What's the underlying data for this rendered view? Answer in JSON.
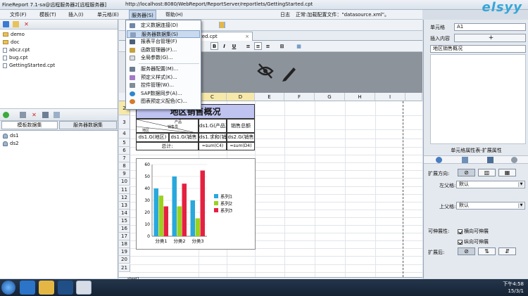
{
  "window": {
    "title": "FineReport 7.1-sa@远程服务器2[远程服务器]",
    "url": "http://localhost:8080/WebReport/ReportServer/reportlets/GettingStarted.cpt",
    "logo": "elsyy"
  },
  "menubar": {
    "items": [
      "文件(F)",
      "模板(T)",
      "插入(I)",
      "单元格(E)",
      "服务器(S)",
      "帮助(H)"
    ],
    "log_label": "日志",
    "status": "正常:加载配置文件：\"datasource.xml\"。"
  },
  "server_menu": {
    "items": [
      "定义数据连接(D)",
      "服务器数据集(S)",
      "报表平台管理(F)",
      "函数管理器(F)...",
      "全局参数(G)...",
      "服务器配置(M)...",
      "预定义样式(K)...",
      "控件管理(W)...",
      "SAP数据同步(A)...",
      "图表预定义配色(C)..."
    ],
    "highlighted_index": 1
  },
  "file_tree": {
    "items": [
      {
        "name": "demo",
        "type": "folder"
      },
      {
        "name": "doc",
        "type": "folder"
      },
      {
        "name": "abcz.cpt",
        "type": "file"
      },
      {
        "name": "bug.cpt",
        "type": "file"
      },
      {
        "name": "GettingStarted.cpt",
        "type": "file"
      }
    ]
  },
  "dataset_panel": {
    "tabs": [
      "模板数据集",
      "服务器数据集"
    ],
    "items": [
      "ds1",
      "ds2"
    ]
  },
  "doc_tab": {
    "label": "ted.cpt"
  },
  "format_bar": {
    "bold": "B",
    "italic": "I",
    "underline": "U"
  },
  "grid": {
    "columns": [
      "C",
      "D",
      "E",
      "F",
      "G",
      "H",
      "I"
    ],
    "rows": [
      "2",
      "3",
      "4",
      "5",
      "6",
      "7",
      "8",
      "9",
      "10",
      "11",
      "12",
      "13",
      "14",
      "15",
      "16",
      "17",
      "18",
      "19",
      "20",
      "21"
    ],
    "title_cell": "地区销售概况",
    "header_product": "产品",
    "header_sales": "销售员",
    "header_region": "地区",
    "cell_product": "ds1.G(产品)",
    "cell_sales_total": "销售总额",
    "cell_region": "ds1.G(地区)",
    "cell_sales": "ds1.G(销售",
    "cell_sum_qty": "ds1.求和(销",
    "cell_ds2": "ds2.G(销售",
    "total_label": "总计:",
    "sum_c4": "=sum(C4)",
    "sum_d4": "=sum(D4)"
  },
  "chart_data": {
    "type": "bar",
    "categories": [
      "分类1",
      "分类2",
      "分类3"
    ],
    "series": [
      {
        "name": "系列1",
        "values": [
          40,
          50,
          30
        ],
        "color": "#29a8de"
      },
      {
        "name": "系列2",
        "values": [
          34,
          25,
          15
        ],
        "color": "#9bd21c"
      },
      {
        "name": "系列3",
        "values": [
          25,
          44,
          55
        ],
        "color": "#e52140"
      }
    ],
    "ylim": [
      0,
      60
    ],
    "yticks": [
      "0",
      "10",
      "20",
      "30",
      "40",
      "50",
      "60"
    ],
    "legend": "right"
  },
  "sheet_tab": {
    "label": "sheet1"
  },
  "right_panel": {
    "cell_label": "单元格",
    "cell_value": "A1",
    "insert_label": "插入内容",
    "insert_button": "+",
    "content_value": "地区销售概况",
    "props_title": "单元格属性表-扩展属性",
    "expand_dir_label": "扩展方向:",
    "left_parent_label": "左父格:",
    "left_parent_value": "默认",
    "up_parent_label": "上父格:",
    "up_parent_value": "默认",
    "scalable_label": "可伸展性:",
    "h_scalable": "横向可伸展",
    "v_scalable": "纵向可伸展",
    "after_expand_label": "扩展后:"
  },
  "taskbar": {
    "time": "下午4:58",
    "date": "15/3/1"
  }
}
